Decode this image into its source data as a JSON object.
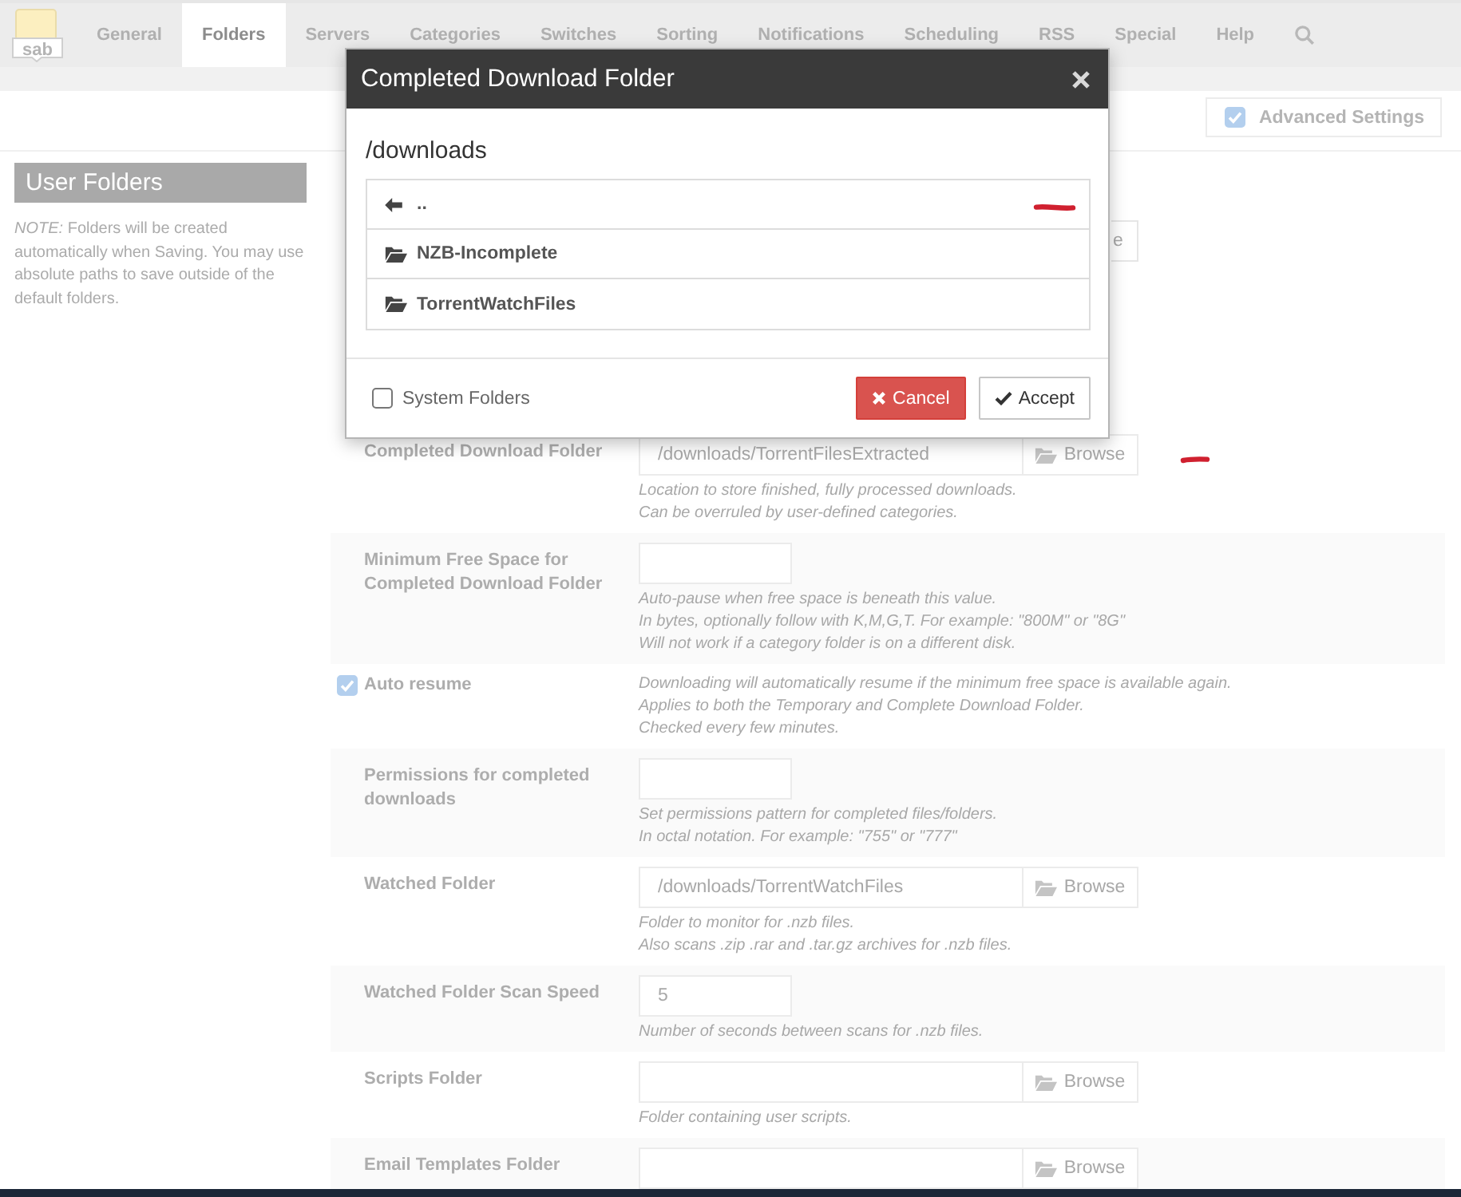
{
  "nav": {
    "logo_text": "sab",
    "items": [
      {
        "label": "General",
        "selected": false
      },
      {
        "label": "Folders",
        "selected": true
      },
      {
        "label": "Servers",
        "selected": false
      },
      {
        "label": "Categories",
        "selected": false
      },
      {
        "label": "Switches",
        "selected": false
      },
      {
        "label": "Sorting",
        "selected": false
      },
      {
        "label": "Notifications",
        "selected": false
      },
      {
        "label": "Scheduling",
        "selected": false
      },
      {
        "label": "RSS",
        "selected": false
      },
      {
        "label": "Special",
        "selected": false
      },
      {
        "label": "Help",
        "selected": false
      }
    ]
  },
  "toolbar": {
    "advanced_settings": {
      "label": "Advanced Settings",
      "checked": true
    }
  },
  "sidebar": {
    "title": "User Folders",
    "note": "*NOTE:* Folders will be created automatically when Saving. You may use absolute paths to save outside of the default folders."
  },
  "covered_button": {
    "label": "e"
  },
  "settings": [
    {
      "kind": "folder",
      "label": "Completed Download Folder",
      "value": "/downloads/TorrentFilesExtracted",
      "button": "Browse",
      "help": [
        "Location to store finished, fully processed downloads.",
        "Can be overruled by user-defined categories."
      ]
    },
    {
      "kind": "number",
      "label": "Minimum Free Space for Completed Download Folder",
      "help": [
        "Auto-pause when free space is beneath this value.",
        "In bytes, optionally follow with K,M,G,T. For example: \"800M\" or \"8G\"",
        "Will not work if a category folder is on a different disk."
      ]
    },
    {
      "kind": "checkbox",
      "label": "Auto resume",
      "checked": true,
      "help": [
        "Downloading will automatically resume if the minimum free space is available again.",
        "Applies to both the Temporary and Complete Download Folder.",
        "Checked every few minutes."
      ]
    },
    {
      "kind": "number",
      "label": "Permissions for completed downloads",
      "help": [
        "Set permissions pattern for completed files/folders.",
        "In octal notation. For example: \"755\" or \"777\""
      ]
    },
    {
      "kind": "folder",
      "label": "Watched Folder",
      "value": "/downloads/TorrentWatchFiles",
      "button": "Browse",
      "help": [
        "Folder to monitor for .nzb files.",
        "Also scans .zip .rar and .tar.gz archives for .nzb files."
      ]
    },
    {
      "kind": "number",
      "label": "Watched Folder Scan Speed",
      "value": "5",
      "help": [
        "Number of seconds between scans for .nzb files."
      ]
    },
    {
      "kind": "folder",
      "label": "Scripts Folder",
      "button": "Browse",
      "help": [
        "Folder containing user scripts."
      ]
    },
    {
      "kind": "folder",
      "label": "Email Templates Folder",
      "button": "Browse"
    }
  ],
  "dialog": {
    "title": "Completed Download Folder",
    "path": "/downloads",
    "entries": [
      {
        "kind": "parent",
        "label": ".."
      },
      {
        "kind": "folder",
        "label": "NZB-Incomplete"
      },
      {
        "kind": "folder",
        "label": "TorrentWatchFiles"
      }
    ],
    "system_folders": {
      "label": "System Folders",
      "checked": false
    },
    "buttons": [
      {
        "kind": "cancel",
        "label": "Cancel"
      },
      {
        "kind": "accept",
        "label": "Accept"
      }
    ]
  }
}
